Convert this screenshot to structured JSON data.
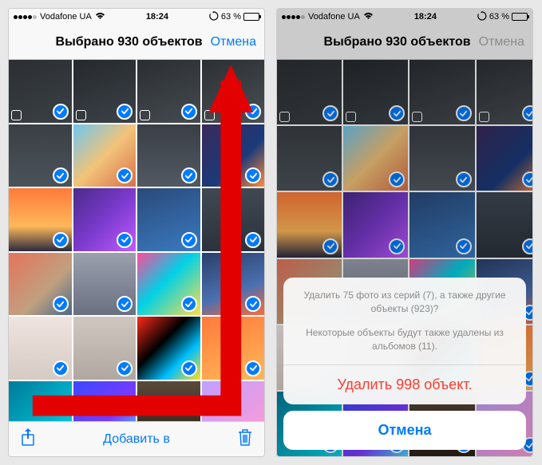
{
  "status": {
    "carrier": "Vodafone UA",
    "time": "18:24",
    "battery_pct": "63 %"
  },
  "nav": {
    "title": "Выбрано 930 объектов",
    "cancel": "Отмена"
  },
  "toolbar": {
    "add_to": "Добавить в"
  },
  "sheet": {
    "line1": "Удалить 75 фото из серий (7), а также другие объекты (923)?",
    "line2": "Некоторые объекты будут также удалены из альбомов (11).",
    "delete": "Удалить 998 объект.",
    "cancel": "Отмена"
  },
  "thumbs": [
    {
      "bg": "linear-gradient(160deg,#2b2f33,#3a4045)",
      "burst": true
    },
    {
      "bg": "linear-gradient(160deg,#25292d,#3b4248)",
      "burst": true
    },
    {
      "bg": "linear-gradient(160deg,#2a2e33,#454b50)",
      "burst": true
    },
    {
      "bg": "linear-gradient(160deg,#2c3034,#494f54)",
      "burst": true
    },
    {
      "bg": "linear-gradient(180deg,#3a3f45,#4b535a)"
    },
    {
      "bg": "linear-gradient(135deg,#6ec6f0,#f2c379 50%,#d8704a)"
    },
    {
      "bg": "linear-gradient(180deg,#3a3f46,#525962)"
    },
    {
      "bg": "linear-gradient(135deg,#3a2a5a,#1a3a7a 60%,#ff8a3d)"
    },
    {
      "bg": "linear-gradient(180deg,#ff7a3a,#ffb85a 60%,#2a2a40)"
    },
    {
      "bg": "linear-gradient(135deg,#4a2a8a,#7a3acc 50%,#c05aff)"
    },
    {
      "bg": "linear-gradient(160deg,#2a4a7a,#3a7ac0)"
    },
    {
      "bg": "linear-gradient(180deg,#404854,#2b323b)"
    },
    {
      "bg": "linear-gradient(135deg,#e6735a,#c0a080 60%,#4a6a8a)"
    },
    {
      "bg": "linear-gradient(180deg,#9aa0ae,#6a7080)"
    },
    {
      "bg": "linear-gradient(135deg,#ff4a9a,#00d0e6 45%,#ffe04a)"
    },
    {
      "bg": "linear-gradient(160deg,#2a3f6a,#4a70b0 60%,#ff6a3a)"
    },
    {
      "bg": "linear-gradient(180deg,#f0e4e0,#d6cac4)"
    },
    {
      "bg": "linear-gradient(180deg,#d0c8c0,#b0a8a0)"
    },
    {
      "bg": "linear-gradient(135deg,#ff2a1a,#000 40%,#00c0ff 70%,#ffe01a)"
    },
    {
      "bg": "linear-gradient(160deg,#ff7a3a,#ffb85a)"
    },
    {
      "bg": "linear-gradient(135deg,#007a9a,#00d4e6)"
    },
    {
      "bg": "linear-gradient(135deg,#3a4aff,#7a3aff 60%,#4ad4ff)"
    },
    {
      "bg": "linear-gradient(180deg,#5a4a3a,#2a2018)"
    },
    {
      "bg": "linear-gradient(135deg,#c0a0ff,#ff9ad4)"
    }
  ]
}
